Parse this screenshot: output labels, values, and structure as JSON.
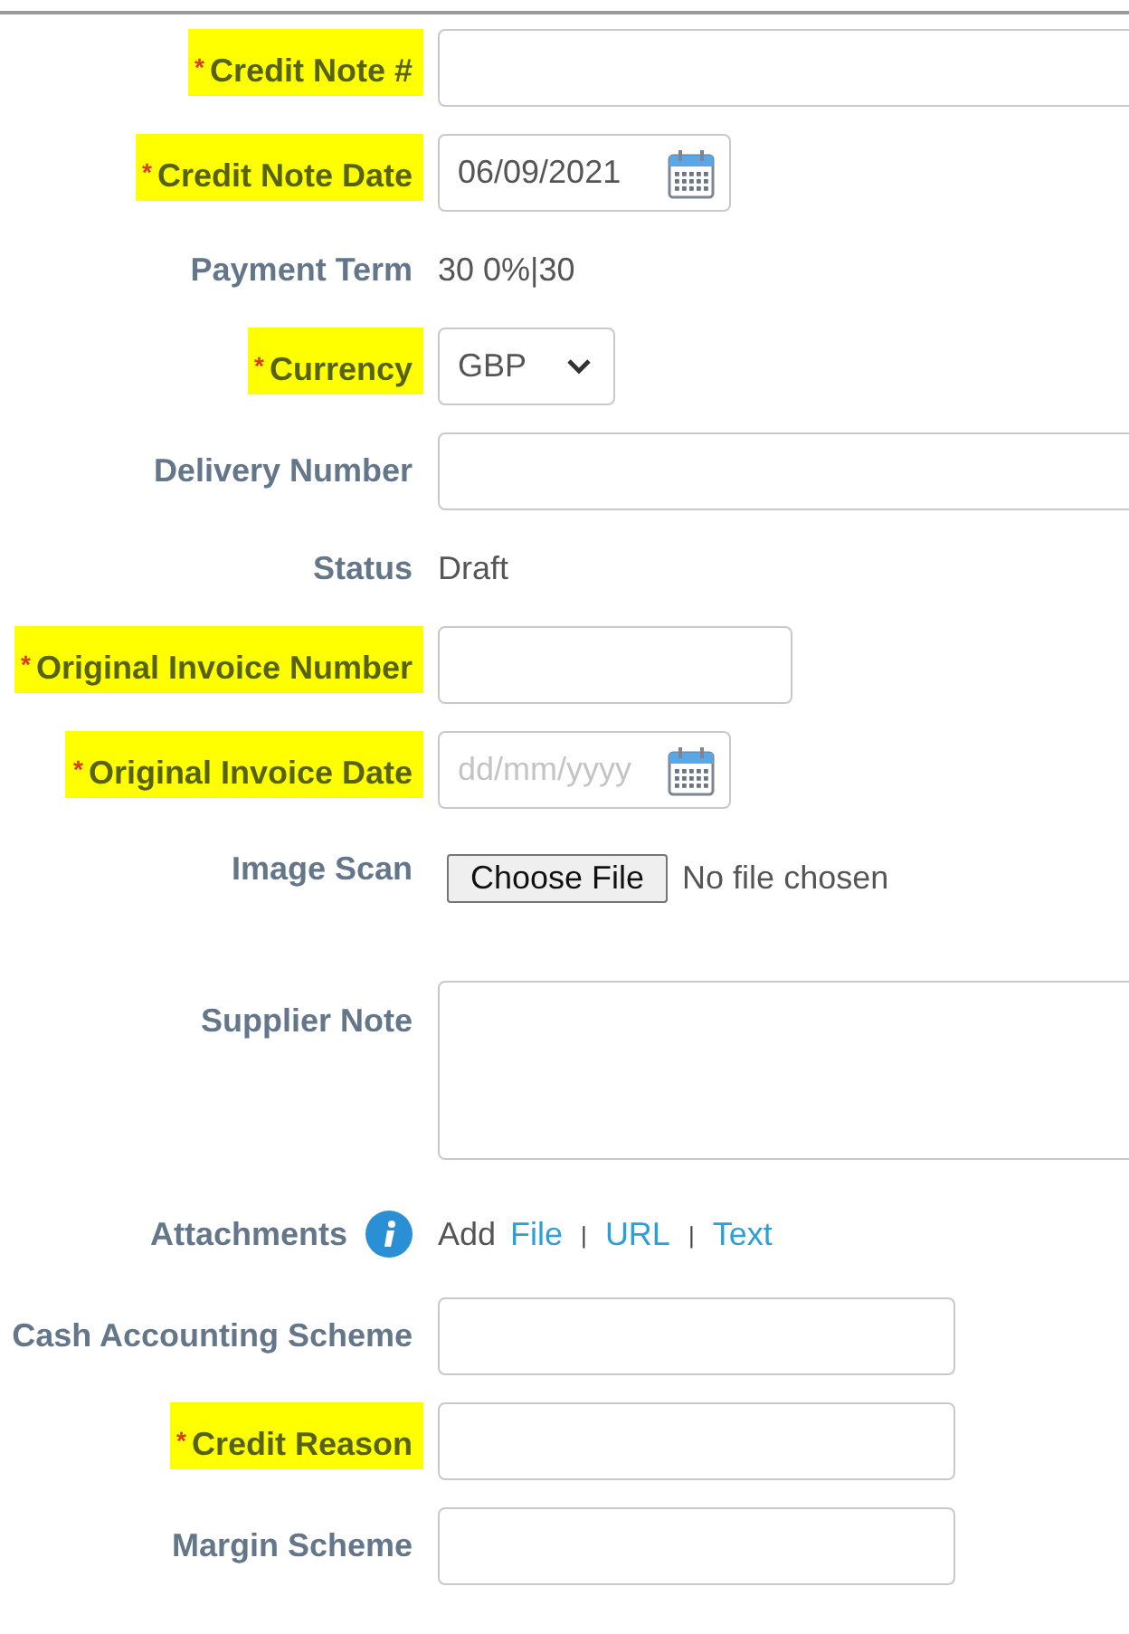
{
  "fields": [
    {
      "kind": "text",
      "label": "Credit Note #",
      "required_mark": "*",
      "highlighted": true
    },
    {
      "kind": "date",
      "label": "Credit Note Date",
      "required_mark": "*",
      "highlighted": true,
      "value": "06/09/2021"
    },
    {
      "kind": "static",
      "label": "Payment Term",
      "highlighted": false,
      "value": "30 0%|30"
    },
    {
      "kind": "select",
      "label": "Currency",
      "required_mark": "*",
      "highlighted": true,
      "value": "GBP"
    },
    {
      "kind": "text",
      "label": "Delivery Number",
      "highlighted": false
    },
    {
      "kind": "static",
      "label": "Status",
      "highlighted": false,
      "value": "Draft"
    },
    {
      "kind": "text",
      "label": "Original Invoice Number",
      "required_mark": "*",
      "highlighted": true
    },
    {
      "kind": "date",
      "label": "Original Invoice Date",
      "required_mark": "*",
      "highlighted": true,
      "placeholder": "dd/mm/yyyy"
    },
    {
      "kind": "file",
      "label": "Image Scan",
      "highlighted": false,
      "button": "Choose File",
      "value": "No file chosen"
    },
    {
      "kind": "textarea",
      "label": "Supplier Note",
      "highlighted": false
    },
    {
      "kind": "attachments",
      "label": "Attachments",
      "highlighted": false,
      "prefix": "Add",
      "links": [
        {
          "label": "File"
        },
        {
          "separator": "|",
          "label": "URL"
        },
        {
          "separator": "|",
          "label": "Text"
        }
      ]
    },
    {
      "kind": "text",
      "label": "Cash Accounting Scheme",
      "highlighted": false
    },
    {
      "kind": "text",
      "label": "Credit Reason",
      "required_mark": "*",
      "highlighted": true
    },
    {
      "kind": "text",
      "label": "Margin Scheme",
      "highlighted": false
    }
  ]
}
